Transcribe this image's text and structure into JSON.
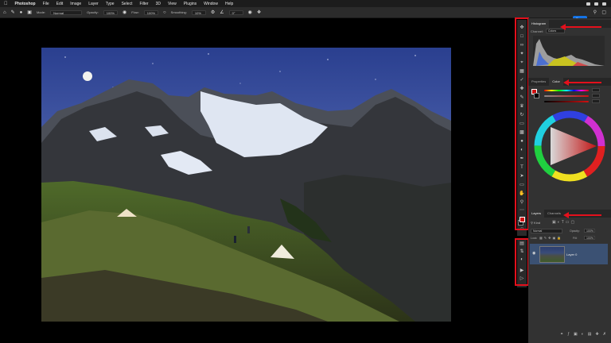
{
  "menubar": {
    "app_name": "Photoshop",
    "items": [
      "File",
      "Edit",
      "Image",
      "Layer",
      "Type",
      "Select",
      "Filter",
      "3D",
      "View",
      "Plugins",
      "Window",
      "Help"
    ]
  },
  "options": {
    "mode_label": "Mode:",
    "mode_value": "Normal",
    "opacity_label": "Opacity:",
    "opacity_value": "100%",
    "flow_label": "Flow:",
    "flow_value": "100%",
    "smoothing_label": "Smoothing:",
    "smoothing_value": "10%",
    "angle_value": "0°",
    "share_label": "Share"
  },
  "panels": {
    "histogram_tab": "Histogram",
    "channel_label": "Channel:",
    "channel_value": "Colors",
    "properties_tab": "Properties",
    "color_tab": "Color",
    "layers_tab": "Layers",
    "channels_tab": "Channels",
    "kind_label": "Kind",
    "blend_value": "Normal",
    "opacity_label": "Opacity:",
    "opacity_value": "100%",
    "lock_label": "Lock:",
    "fill_label": "Fill:",
    "fill_value": "100%",
    "layer_name": "Layer 0"
  },
  "colors": {
    "foreground": "#d01010",
    "background": "#000000",
    "annotation_red": "#e3101c",
    "selected_layer": "#3b5173"
  }
}
